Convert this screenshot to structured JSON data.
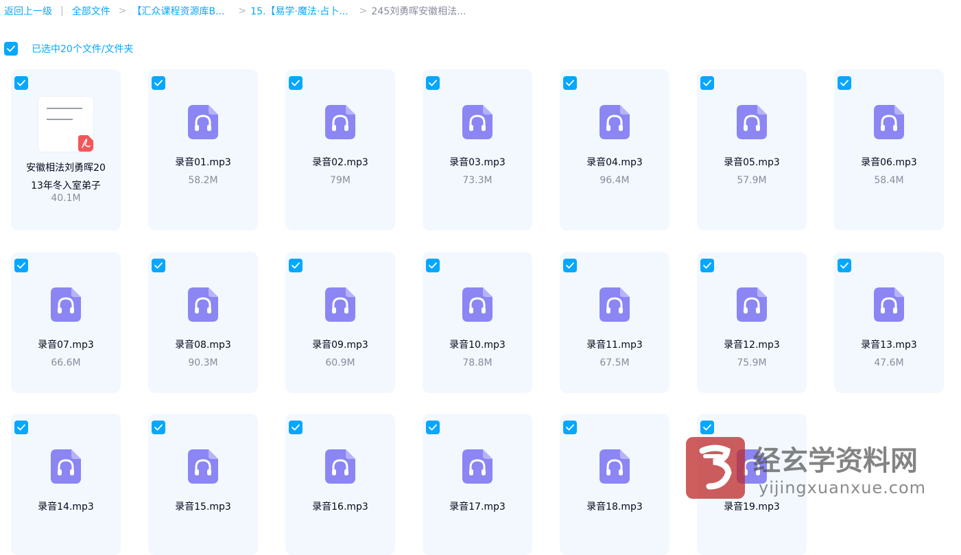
{
  "breadcrumb": {
    "back": "返回上一级",
    "sep1": "|",
    "all_files": "全部文件",
    "seg1": "【汇众课程资源库B...",
    "seg2": "15.【易学·魔法·占卜...",
    "current": "245刘勇晖安徽相法..."
  },
  "selection": {
    "label": "已选中20个文件/文件夹"
  },
  "files": [
    {
      "type": "pdf",
      "name_line1": "安徽相法刘勇晖20",
      "name_line2": "13年冬入室弟子",
      "size": "40.1M"
    },
    {
      "type": "mp3",
      "name": "录音01.mp3",
      "size": "58.2M"
    },
    {
      "type": "mp3",
      "name": "录音02.mp3",
      "size": "79M"
    },
    {
      "type": "mp3",
      "name": "录音03.mp3",
      "size": "73.3M"
    },
    {
      "type": "mp3",
      "name": "录音04.mp3",
      "size": "96.4M"
    },
    {
      "type": "mp3",
      "name": "录音05.mp3",
      "size": "57.9M"
    },
    {
      "type": "mp3",
      "name": "录音06.mp3",
      "size": "58.4M"
    },
    {
      "type": "mp3",
      "name": "录音07.mp3",
      "size": "66.6M"
    },
    {
      "type": "mp3",
      "name": "录音08.mp3",
      "size": "90.3M"
    },
    {
      "type": "mp3",
      "name": "录音09.mp3",
      "size": "60.9M"
    },
    {
      "type": "mp3",
      "name": "录音10.mp3",
      "size": "78.8M"
    },
    {
      "type": "mp3",
      "name": "录音11.mp3",
      "size": "67.5M"
    },
    {
      "type": "mp3",
      "name": "录音12.mp3",
      "size": "75.9M"
    },
    {
      "type": "mp3",
      "name": "录音13.mp3",
      "size": "47.6M"
    },
    {
      "type": "mp3",
      "name": "录音14.mp3"
    },
    {
      "type": "mp3",
      "name": "录音15.mp3"
    },
    {
      "type": "mp3",
      "name": "录音16.mp3"
    },
    {
      "type": "mp3",
      "name": "录音17.mp3"
    },
    {
      "type": "mp3",
      "name": "录音18.mp3"
    },
    {
      "type": "mp3",
      "name": "录音19.mp3"
    }
  ],
  "watermark": {
    "title": "经玄学资料网",
    "url": "yijingxuanxue.com",
    "seal_char": "易"
  },
  "colors": {
    "accent": "#06a7ff",
    "card_bg": "#f3f8ff",
    "audio_icon": "#8b86f3",
    "pdf_red": "#f2575a",
    "text": "#03081a",
    "subtext": "#878c9c"
  },
  "icons": {
    "audio": "headphones-icon",
    "pdf": "pdf-icon",
    "check": "check-icon"
  }
}
